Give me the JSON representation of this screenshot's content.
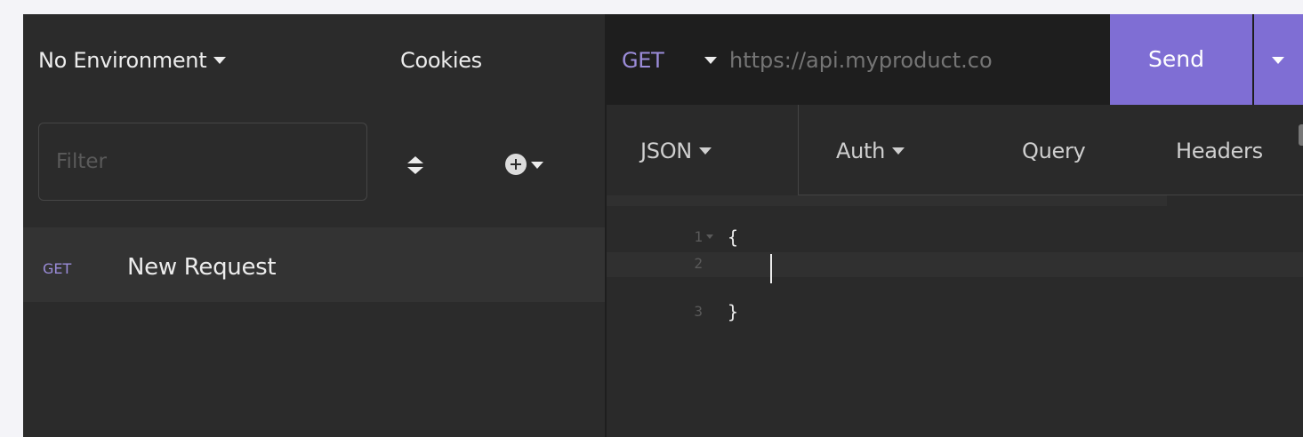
{
  "sidebar": {
    "environment_label": "No Environment",
    "cookies_label": "Cookies",
    "filter_placeholder": "Filter",
    "requests": [
      {
        "method": "GET",
        "name": "New Request"
      }
    ]
  },
  "request": {
    "method": "GET",
    "url": "https://api.myproduct.co",
    "send_label": "Send"
  },
  "tabs": [
    {
      "label": "JSON"
    },
    {
      "label": "Auth"
    },
    {
      "label": "Query"
    },
    {
      "label": "Headers"
    }
  ],
  "editor": {
    "lines": [
      {
        "number": "1",
        "text": "{"
      },
      {
        "number": "2",
        "text": ""
      },
      {
        "number": "3",
        "text": "}"
      }
    ]
  },
  "colors": {
    "accent": "#7f6ed4",
    "method_get": "#9b8cd9",
    "sidebar_bg": "#2b2b2b",
    "url_bar_bg": "#1e1e1e"
  }
}
